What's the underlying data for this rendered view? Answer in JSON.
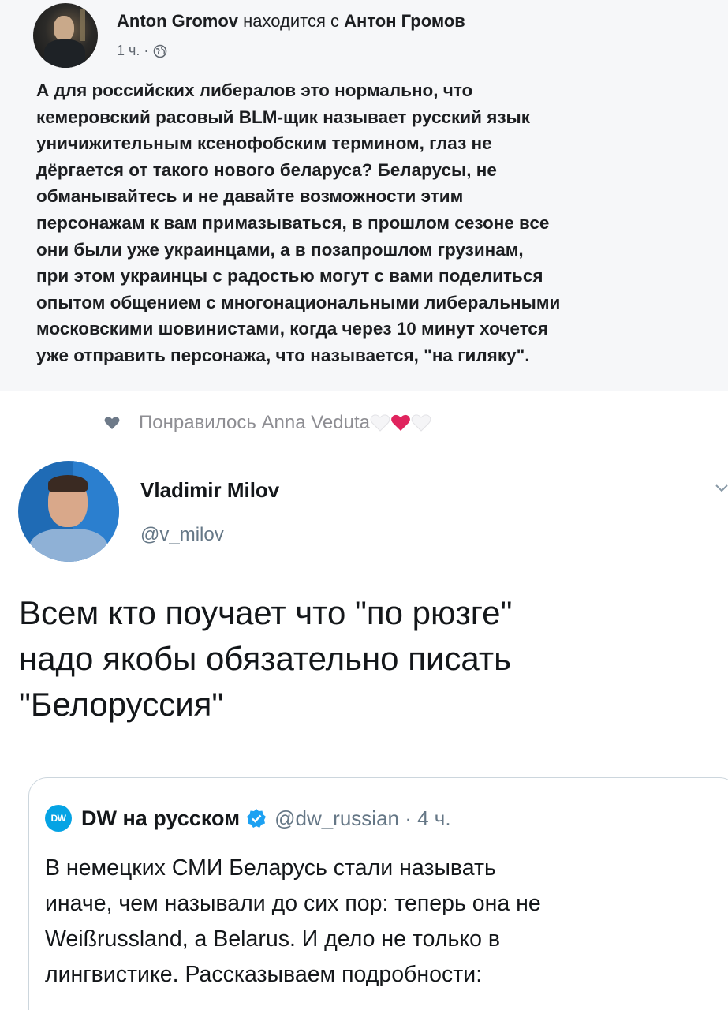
{
  "fb_post": {
    "author": "Anton Gromov",
    "with_text": "находится с",
    "tagged": "Антон Громов",
    "time": "1 ч. ·",
    "text_lines": [
      "А для российских либералов это нормально, что",
      "кемеровский расовый BLM-щик называет русский язык",
      "уничижительным ксенофобским термином, глаз не",
      "дёргается от такого нового беларуса? Беларусы, не",
      "обманывайтесь и не давайте возможности этим",
      "персонажам к вам примазываться, в прошлом сезоне все",
      "они были уже украинцами, а в позапрошлом грузинам,",
      "при этом украинцы с радостью могут с вами поделиться",
      "опытом общением с многонациональными либеральными",
      "московскими шовинистами, когда через 10 минут хочется",
      "уже отправить персонажа, что называется, \"на гиляку\"."
    ]
  },
  "liked": {
    "text": "Понравилось Anna Veduta"
  },
  "tweet": {
    "name": "Vladimir Milov",
    "handle": "@v_milov",
    "text_lines": [
      "Всем кто поучает что \"по рюзге\"",
      "надо якобы обязательно писать",
      "\"Белоруссия\""
    ]
  },
  "quoted": {
    "logo_text": "DW",
    "name": "DW на русском",
    "handle_time": "@dw_russian · 4 ч.",
    "text_lines": [
      "В немецких СМИ Беларусь стали называть",
      "иначе, чем называли до сих пор: теперь она не",
      "Weißrussland, а Belarus. И дело не только в",
      "лингвистике. Рассказываем подробности:"
    ]
  },
  "colors": {
    "fb_bg": "#f6f7f9",
    "twitter_gray": "#657786",
    "heart_red": "#e0245e",
    "verified_blue": "#1da1f2",
    "dw_blue": "#05a3e4"
  }
}
